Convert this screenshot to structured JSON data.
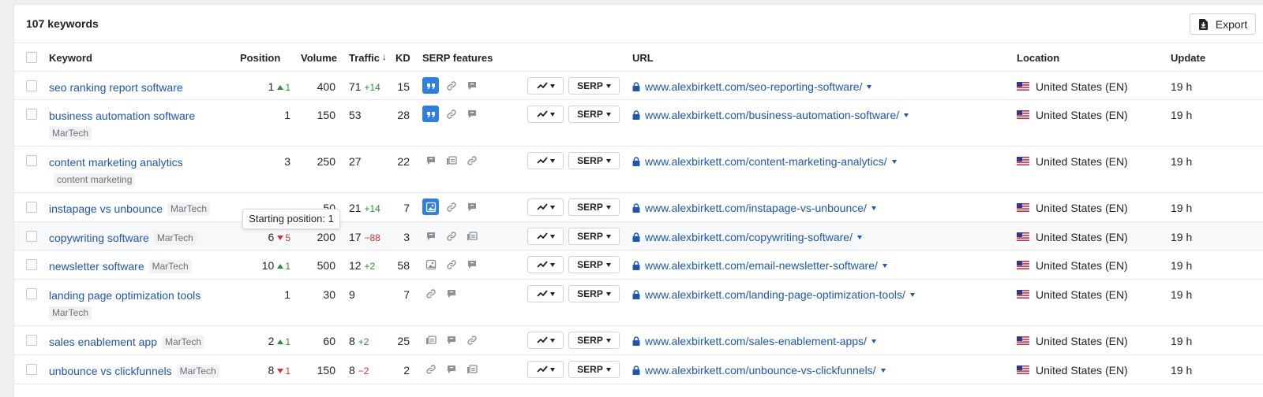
{
  "header": {
    "count_label": "107 keywords",
    "export_label": "Export"
  },
  "columns": {
    "keyword": "Keyword",
    "position": "Position",
    "volume": "Volume",
    "traffic": "Traffic",
    "kd": "KD",
    "serp_features": "SERP features",
    "url": "URL",
    "location": "Location",
    "update": "Update"
  },
  "serp_button_label": "SERP",
  "tooltip": "Starting position: 1",
  "colors": {
    "link": "#1e56b3",
    "up": "#2e8b3a",
    "down": "#d63131",
    "serp_active": "#2f7fe0"
  },
  "rows": [
    {
      "keyword": "seo ranking report software",
      "tag": "",
      "position": "1",
      "pos_dir": "up",
      "pos_delta": "1",
      "volume": "400",
      "traffic": "71",
      "traffic_dir": "up",
      "traffic_delta": "+14",
      "kd": "15",
      "serp": [
        "quote-active-icon",
        "link-icon",
        "review-icon"
      ],
      "url": "www.alexbirkett.com/seo-reporting-software/",
      "location": "United States (EN)",
      "update": "19 h"
    },
    {
      "keyword": "business automation software",
      "tag": "MarTech",
      "position": "1",
      "pos_dir": "",
      "pos_delta": "",
      "volume": "150",
      "traffic": "53",
      "traffic_dir": "",
      "traffic_delta": "",
      "kd": "28",
      "serp": [
        "quote-active-icon",
        "link-icon",
        "review-icon"
      ],
      "url": "www.alexbirkett.com/business-automation-software/",
      "location": "United States (EN)",
      "update": "19 h"
    },
    {
      "keyword": "content marketing analytics",
      "tag": "content marketing",
      "position": "3",
      "pos_dir": "",
      "pos_delta": "",
      "volume": "250",
      "traffic": "27",
      "traffic_dir": "",
      "traffic_delta": "",
      "kd": "22",
      "serp": [
        "review-icon",
        "thumbnails-icon",
        "link-icon"
      ],
      "url": "www.alexbirkett.com/content-marketing-analytics/",
      "location": "United States (EN)",
      "update": "19 h"
    },
    {
      "keyword": "instapage vs unbounce",
      "tag": "MarTech",
      "position": "",
      "pos_dir": "",
      "pos_delta": "",
      "volume": "50",
      "traffic": "21",
      "traffic_dir": "up",
      "traffic_delta": "+14",
      "kd": "7",
      "serp": [
        "image-active-icon",
        "link-icon",
        "review-icon"
      ],
      "url": "www.alexbirkett.com/instapage-vs-unbounce/",
      "location": "United States (EN)",
      "update": "19 h"
    },
    {
      "keyword": "copywriting software",
      "tag": "MarTech",
      "position": "6",
      "pos_dir": "down",
      "pos_delta": "5",
      "volume": "200",
      "traffic": "17",
      "traffic_dir": "down",
      "traffic_delta": "−88",
      "kd": "3",
      "serp": [
        "review-icon",
        "link-icon",
        "thumbnails-icon"
      ],
      "url": "www.alexbirkett.com/copywriting-software/",
      "location": "United States (EN)",
      "update": "19 h"
    },
    {
      "keyword": "newsletter software",
      "tag": "MarTech",
      "position": "10",
      "pos_dir": "up",
      "pos_delta": "1",
      "volume": "500",
      "traffic": "12",
      "traffic_dir": "up",
      "traffic_delta": "+2",
      "kd": "58",
      "serp": [
        "image-icon",
        "link-icon",
        "review-icon"
      ],
      "url": "www.alexbirkett.com/email-newsletter-software/",
      "location": "United States (EN)",
      "update": "19 h"
    },
    {
      "keyword": "landing page optimization tools",
      "tag": "MarTech",
      "position": "1",
      "pos_dir": "",
      "pos_delta": "",
      "volume": "30",
      "traffic": "9",
      "traffic_dir": "",
      "traffic_delta": "",
      "kd": "7",
      "serp": [
        "link-icon",
        "review-icon"
      ],
      "url": "www.alexbirkett.com/landing-page-optimization-tools/",
      "location": "United States (EN)",
      "update": "19 h"
    },
    {
      "keyword": "sales enablement app",
      "tag": "MarTech",
      "position": "2",
      "pos_dir": "up",
      "pos_delta": "1",
      "volume": "60",
      "traffic": "8",
      "traffic_dir": "up",
      "traffic_delta": "+2",
      "kd": "25",
      "serp": [
        "thumbnails-icon",
        "review-icon",
        "link-icon"
      ],
      "url": "www.alexbirkett.com/sales-enablement-apps/",
      "location": "United States (EN)",
      "update": "19 h"
    },
    {
      "keyword": "unbounce vs clickfunnels",
      "tag": "MarTech",
      "position": "8",
      "pos_dir": "down",
      "pos_delta": "1",
      "volume": "150",
      "traffic": "8",
      "traffic_dir": "down",
      "traffic_delta": "−2",
      "kd": "2",
      "serp": [
        "link-icon",
        "review-icon",
        "thumbnails-icon"
      ],
      "url": "www.alexbirkett.com/unbounce-vs-clickfunnels/",
      "location": "United States (EN)",
      "update": "19 h"
    }
  ]
}
